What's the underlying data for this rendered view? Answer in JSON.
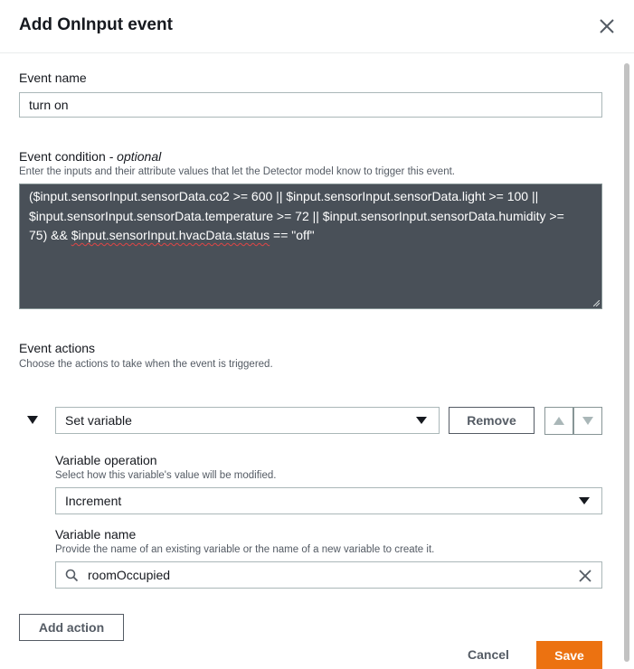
{
  "dialog": {
    "title": "Add OnInput event",
    "close_icon": "close-icon"
  },
  "event_name": {
    "label": "Event name",
    "value": "turn on"
  },
  "event_condition": {
    "label": "Event condition",
    "label_suffix": "- optional",
    "description": "Enter the inputs and their attribute values that let the Detector model know to trigger this event.",
    "expression_line1_a": "($input.sensorInput.sensorData.co2 >= 600 || $input.sensorInput.sensorData.light >= 100 ||",
    "expression_line2": "$input.sensorInput.sensorData.temperature >= 72 || $input.sensorInput.sensorData.humidity >=",
    "expression_line3_a": "75) && ",
    "expression_line3_b": "$input.sensorInput.hvacData.status",
    "expression_line3_c": " == \"off\""
  },
  "event_actions": {
    "label": "Event actions",
    "description": "Choose the actions to take when the event is triggered.",
    "action_type": "Set variable",
    "remove_label": "Remove",
    "variable_operation": {
      "label": "Variable operation",
      "description": "Select how this variable's value will be modified.",
      "value": "Increment"
    },
    "variable_name": {
      "label": "Variable name",
      "description": "Provide the name of an existing variable or the name of a new variable to create it.",
      "value": "roomOccupied"
    },
    "add_action_label": "Add action"
  },
  "footer": {
    "cancel_label": "Cancel",
    "save_label": "Save"
  },
  "colors": {
    "primary": "#ec7211",
    "code_background": "#495058",
    "border": "#aab7b8"
  }
}
